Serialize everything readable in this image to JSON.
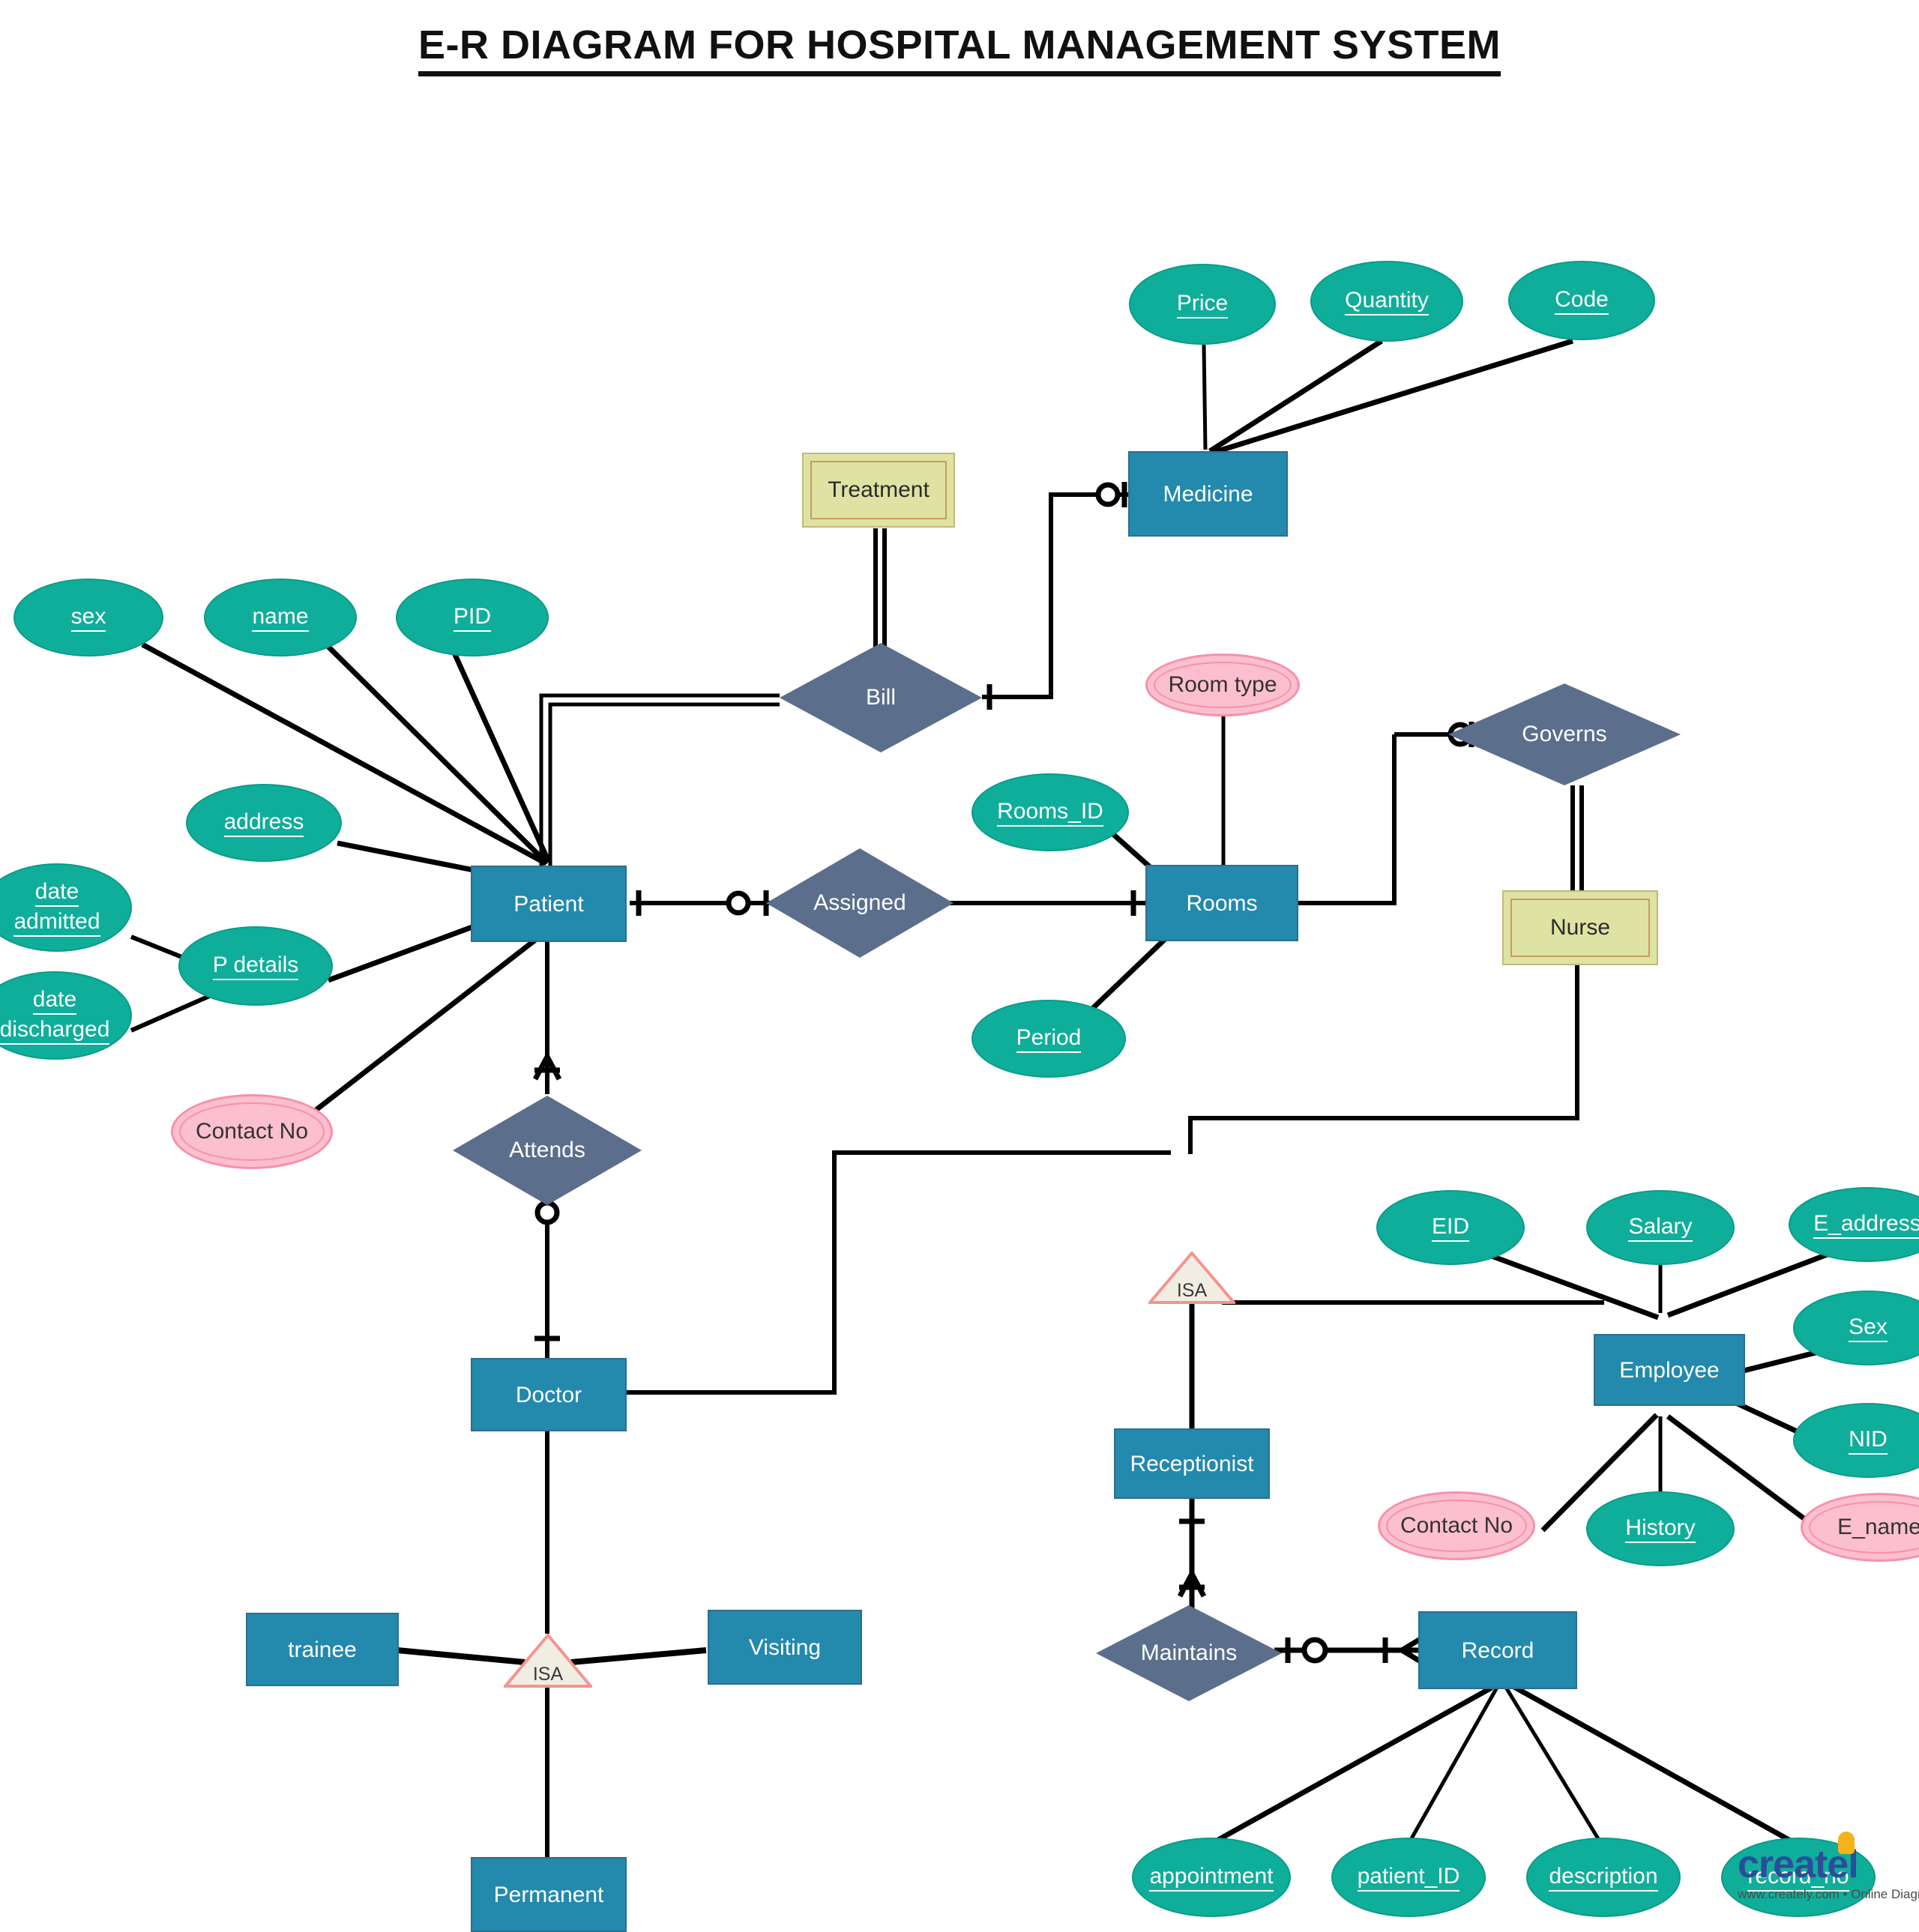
{
  "title": "E-R DIAGRAM FOR HOSPITAL MANAGEMENT SYSTEM",
  "entities": {
    "medicine": "Medicine",
    "patient": "Patient",
    "rooms": "Rooms",
    "doctor": "Doctor",
    "employee": "Employee",
    "receptionist": "Receptionist",
    "record": "Record",
    "trainee": "trainee",
    "visiting": "Visiting",
    "permanent": "Permanent"
  },
  "weak_entities": {
    "treatment": "Treatment",
    "nurse": "Nurse"
  },
  "relationships": {
    "bill": "Bill",
    "assigned": "Assigned",
    "attends": "Attends",
    "governs": "Governs",
    "maintains": "Maintains"
  },
  "specializations": {
    "isa_doctor": "ISA",
    "isa_employee": "ISA"
  },
  "attributes": {
    "price": "Price",
    "quantity": "Quantity",
    "code": "Code",
    "sex": "sex",
    "name": "name",
    "pid": "PID",
    "address": "address",
    "date_admitted_1": "date",
    "date_admitted_2": "admitted",
    "date_discharged_1": "date",
    "date_discharged_2": "discharged",
    "p_details": "P details",
    "rooms_id": "Rooms_ID",
    "period": "Period",
    "eid": "EID",
    "salary": "Salary",
    "e_address": "E_address",
    "sex_emp": "Sex",
    "nid": "NID",
    "history": "History",
    "appointment": "appointment",
    "patient_id": "patient_ID",
    "description": "description",
    "record_no": "record_no"
  },
  "multivalued_attributes": {
    "room_type": "Room type",
    "contact_no_patient": "Contact No",
    "contact_no_employee": "Contact No",
    "e_name": "E_name"
  },
  "watermark": {
    "word": "createl",
    "sub": "www.creately.com • Online Diagram"
  },
  "colors": {
    "entity_fill": "#2389AD",
    "entity_stroke": "#2E6E8E",
    "weak_entity_fill": "#DEE3A3",
    "weak_entity_stroke": "#C99B5E",
    "relationship_fill": "#5B6E8C",
    "attribute_fill": "#0FAE9B",
    "multivalued_fill": "#FBBFCD",
    "multivalued_stroke": "#F98FAB",
    "isa_fill": "#F2EDE2",
    "isa_stroke": "#F4948F",
    "line": "#000000",
    "title": "#111111"
  }
}
